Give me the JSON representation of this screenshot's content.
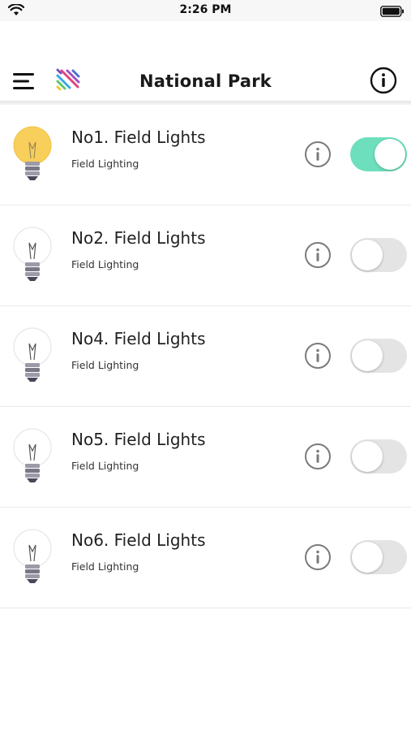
{
  "status_bar": {
    "time": "2:26 PM"
  },
  "nav": {
    "title": "National Park"
  },
  "lights": [
    {
      "title": "No1. Field Lights",
      "subtitle": "Field Lighting",
      "on": true
    },
    {
      "title": "No2. Field Lights",
      "subtitle": "Field Lighting",
      "on": false
    },
    {
      "title": "No4. Field Lights",
      "subtitle": "Field Lighting",
      "on": false
    },
    {
      "title": "No5. Field Lights",
      "subtitle": "Field Lighting",
      "on": false
    },
    {
      "title": "No6. Field Lights",
      "subtitle": "Field Lighting",
      "on": false
    }
  ],
  "colors": {
    "toggle_on": "#6edfbd",
    "toggle_off": "#e4e4e4",
    "bulb_on": "#f7cf5a"
  },
  "icons": {
    "menu": "menu-icon",
    "logo": "logo-icon",
    "info": "info-icon",
    "bulb": "light-bulb-icon",
    "wifi": "wifi-icon",
    "battery": "battery-icon"
  }
}
